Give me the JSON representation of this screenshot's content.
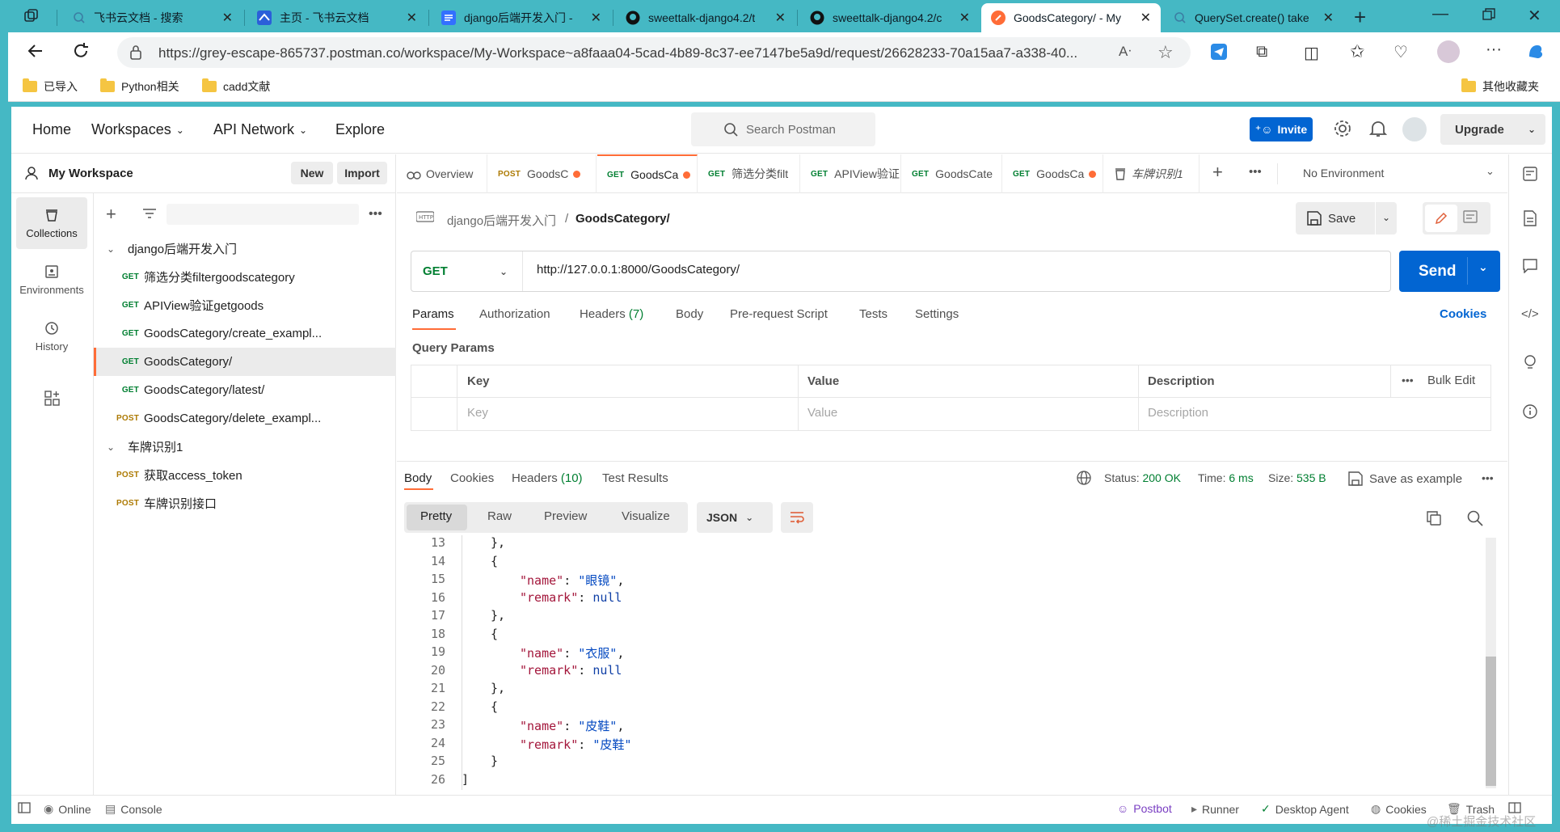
{
  "browser": {
    "tabs": [
      {
        "title": "飞书云文档 - 搜索",
        "active": false
      },
      {
        "title": "主页 - 飞书云文档",
        "active": false
      },
      {
        "title": "django后端开发入门 -",
        "active": false
      },
      {
        "title": "sweettalk-django4.2/t",
        "active": false
      },
      {
        "title": "sweettalk-django4.2/c",
        "active": false
      },
      {
        "title": "GoodsCategory/ - My",
        "active": true
      },
      {
        "title": "QuerySet.create() take",
        "active": false
      }
    ],
    "url": "https://grey-escape-865737.postman.co/workspace/My-Workspace~a8faaa04-5cad-4b89-8c37-ee7147be5a9d/request/26628233-70a15aa7-a338-40...",
    "bookmarks": [
      "已导入",
      "Python相关",
      "cadd文献"
    ],
    "other_bookmarks": "其他收藏夹"
  },
  "nav": {
    "home": "Home",
    "workspaces": "Workspaces",
    "api_network": "API Network",
    "explore": "Explore",
    "search_placeholder": "Search Postman",
    "invite": "Invite",
    "upgrade": "Upgrade"
  },
  "sidebar": {
    "workspace": "My Workspace",
    "new": "New",
    "import": "Import",
    "ribbon": {
      "collections": "Collections",
      "environments": "Environments",
      "history": "History"
    },
    "collections": [
      {
        "name": "django后端开发入门",
        "items": [
          {
            "method": "GET",
            "name": "筛选分类filtergoodscategory",
            "selected": false
          },
          {
            "method": "GET",
            "name": "APIView验证getgoods",
            "selected": false
          },
          {
            "method": "GET",
            "name": "GoodsCategory/create_exampl...",
            "selected": false
          },
          {
            "method": "GET",
            "name": "GoodsCategory/",
            "selected": true
          },
          {
            "method": "GET",
            "name": "GoodsCategory/latest/",
            "selected": false
          },
          {
            "method": "POST",
            "name": "GoodsCategory/delete_exampl...",
            "selected": false
          }
        ]
      },
      {
        "name": "车牌识别1",
        "items": [
          {
            "method": "POST",
            "name": "获取access_token",
            "selected": false
          },
          {
            "method": "POST",
            "name": "车牌识别接口",
            "selected": false
          }
        ]
      }
    ]
  },
  "request_tabs": {
    "overview": "Overview",
    "tabs": [
      {
        "method": "POST",
        "name": "GoodsC"
      },
      {
        "method": "GET",
        "name": "GoodsCa"
      },
      {
        "method": "GET",
        "name": "筛选分类filt"
      },
      {
        "method": "GET",
        "name": "APIView验证"
      },
      {
        "method": "GET",
        "name": "GoodsCate"
      },
      {
        "method": "GET",
        "name": "GoodsCa"
      },
      {
        "method": "",
        "name": "车牌识别1"
      }
    ],
    "environment": "No Environment"
  },
  "request": {
    "breadcrumb_collection": "django后端开发入门",
    "breadcrumb_separator": "/",
    "name": "GoodsCategory/",
    "save": "Save",
    "method": "GET",
    "url": "http://127.0.0.1:8000/GoodsCategory/",
    "send": "Send",
    "tabs": [
      "Params",
      "Authorization",
      "Headers",
      "Body",
      "Pre-request Script",
      "Tests",
      "Settings"
    ],
    "headers_count": "(7)",
    "cookies": "Cookies",
    "query_params_title": "Query Params",
    "columns": [
      "Key",
      "Value",
      "Description"
    ],
    "bulk_edit": "Bulk Edit",
    "placeholders": [
      "Key",
      "Value",
      "Description"
    ]
  },
  "response": {
    "tabs": [
      "Body",
      "Cookies",
      "Headers",
      "Test Results"
    ],
    "headers_count": "(10)",
    "status_label": "Status:",
    "status": "200 OK",
    "time_label": "Time:",
    "time": "6 ms",
    "size_label": "Size:",
    "size": "535 B",
    "save_example": "Save as example",
    "formats": [
      "Pretty",
      "Raw",
      "Preview",
      "Visualize"
    ],
    "format_type": "JSON",
    "code": [
      {
        "n": "13",
        "indent": 1,
        "parts": [
          [
            "p",
            "},"
          ]
        ]
      },
      {
        "n": "14",
        "indent": 1,
        "parts": [
          [
            "p",
            "{"
          ]
        ]
      },
      {
        "n": "15",
        "indent": 2,
        "parts": [
          [
            "k",
            "\"name\""
          ],
          [
            "p",
            ": "
          ],
          [
            "s",
            "\"眼镜\""
          ],
          [
            "p",
            ","
          ]
        ]
      },
      {
        "n": "16",
        "indent": 2,
        "parts": [
          [
            "k",
            "\"remark\""
          ],
          [
            "p",
            ": "
          ],
          [
            "n",
            "null"
          ]
        ]
      },
      {
        "n": "17",
        "indent": 1,
        "parts": [
          [
            "p",
            "},"
          ]
        ]
      },
      {
        "n": "18",
        "indent": 1,
        "parts": [
          [
            "p",
            "{"
          ]
        ]
      },
      {
        "n": "19",
        "indent": 2,
        "parts": [
          [
            "k",
            "\"name\""
          ],
          [
            "p",
            ": "
          ],
          [
            "s",
            "\"衣服\""
          ],
          [
            "p",
            ","
          ]
        ]
      },
      {
        "n": "20",
        "indent": 2,
        "parts": [
          [
            "k",
            "\"remark\""
          ],
          [
            "p",
            ": "
          ],
          [
            "n",
            "null"
          ]
        ]
      },
      {
        "n": "21",
        "indent": 1,
        "parts": [
          [
            "p",
            "},"
          ]
        ]
      },
      {
        "n": "22",
        "indent": 1,
        "parts": [
          [
            "p",
            "{"
          ]
        ]
      },
      {
        "n": "23",
        "indent": 2,
        "parts": [
          [
            "k",
            "\"name\""
          ],
          [
            "p",
            ": "
          ],
          [
            "s",
            "\"皮鞋\""
          ],
          [
            "p",
            ","
          ]
        ]
      },
      {
        "n": "24",
        "indent": 2,
        "parts": [
          [
            "k",
            "\"remark\""
          ],
          [
            "p",
            ": "
          ],
          [
            "s",
            "\"皮鞋\""
          ]
        ]
      },
      {
        "n": "25",
        "indent": 1,
        "parts": [
          [
            "p",
            "}"
          ]
        ]
      },
      {
        "n": "26",
        "indent": 0,
        "parts": [
          [
            "p",
            "]"
          ]
        ]
      }
    ]
  },
  "statusbar": {
    "online": "Online",
    "console": "Console",
    "postbot": "Postbot",
    "runner": "Runner",
    "desktop_agent": "Desktop Agent",
    "cookies": "Cookies",
    "trash": "Trash",
    "watermark": "@稀土掘金技术社区"
  },
  "colors": {
    "brand_orange": "#ff6c37",
    "primary_blue": "#0265d2",
    "get_green": "#007f31",
    "post_yellow": "#ad7a03",
    "browser_teal": "#45b8c4"
  }
}
